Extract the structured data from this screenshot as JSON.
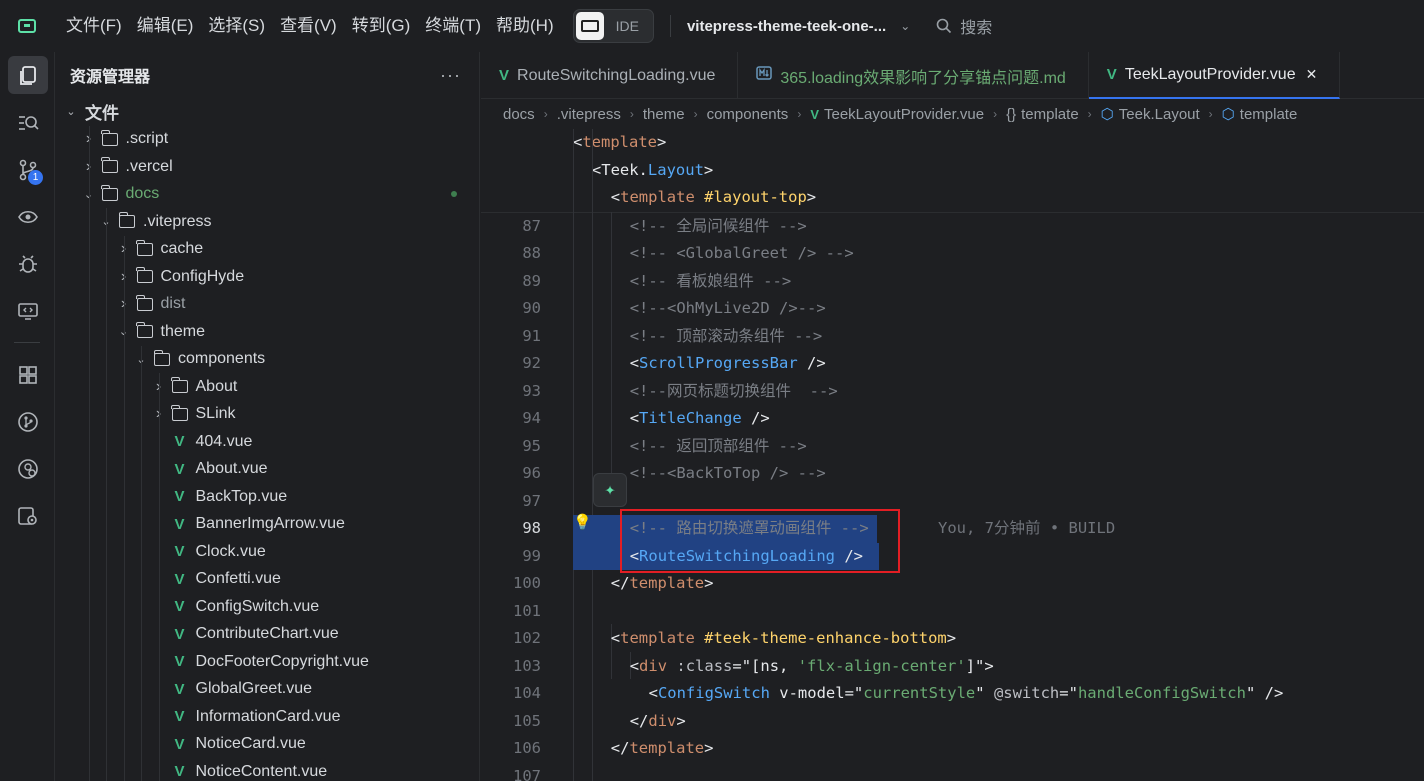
{
  "menu": [
    "文件(F)",
    "编辑(E)",
    "选择(S)",
    "查看(V)",
    "转到(G)",
    "终端(T)",
    "帮助(H)"
  ],
  "ide_label": "IDE",
  "project_name": "vitepress-theme-teek-one-...",
  "search_placeholder": "搜索",
  "activity": {
    "badge": "1"
  },
  "explorer": {
    "title": "资源管理器",
    "more": "···",
    "items": [
      {
        "label": "文件",
        "depth": 0,
        "type": "root",
        "expanded": true
      },
      {
        "label": ".script",
        "depth": 1,
        "type": "folder",
        "expanded": false
      },
      {
        "label": ".vercel",
        "depth": 1,
        "type": "folder",
        "expanded": false
      },
      {
        "label": "docs",
        "depth": 1,
        "type": "folder",
        "expanded": true,
        "modified": true
      },
      {
        "label": ".vitepress",
        "depth": 2,
        "type": "folder",
        "expanded": true
      },
      {
        "label": "cache",
        "depth": 3,
        "type": "folder",
        "expanded": false
      },
      {
        "label": "ConfigHyde",
        "depth": 3,
        "type": "folder",
        "expanded": false
      },
      {
        "label": "dist",
        "depth": 3,
        "type": "folder",
        "expanded": false,
        "dim": true
      },
      {
        "label": "theme",
        "depth": 3,
        "type": "folder",
        "expanded": true
      },
      {
        "label": "components",
        "depth": 4,
        "type": "folder",
        "expanded": true
      },
      {
        "label": "About",
        "depth": 5,
        "type": "folder",
        "expanded": false
      },
      {
        "label": "SLink",
        "depth": 5,
        "type": "folder",
        "expanded": false
      },
      {
        "label": "404.vue",
        "depth": 5,
        "type": "vue"
      },
      {
        "label": "About.vue",
        "depth": 5,
        "type": "vue"
      },
      {
        "label": "BackTop.vue",
        "depth": 5,
        "type": "vue"
      },
      {
        "label": "BannerImgArrow.vue",
        "depth": 5,
        "type": "vue"
      },
      {
        "label": "Clock.vue",
        "depth": 5,
        "type": "vue"
      },
      {
        "label": "Confetti.vue",
        "depth": 5,
        "type": "vue"
      },
      {
        "label": "ConfigSwitch.vue",
        "depth": 5,
        "type": "vue"
      },
      {
        "label": "ContributeChart.vue",
        "depth": 5,
        "type": "vue"
      },
      {
        "label": "DocFooterCopyright.vue",
        "depth": 5,
        "type": "vue"
      },
      {
        "label": "GlobalGreet.vue",
        "depth": 5,
        "type": "vue"
      },
      {
        "label": "InformationCard.vue",
        "depth": 5,
        "type": "vue"
      },
      {
        "label": "NoticeCard.vue",
        "depth": 5,
        "type": "vue"
      },
      {
        "label": "NoticeContent.vue",
        "depth": 5,
        "type": "vue"
      }
    ]
  },
  "tabs": [
    {
      "label": "RouteSwitchingLoading.vue",
      "type": "vue",
      "active": false
    },
    {
      "label": "365.loading效果影响了分享锚点问题.md",
      "type": "md",
      "active": false
    },
    {
      "label": "TeekLayoutProvider.vue",
      "type": "vue",
      "active": true,
      "close": "✕"
    }
  ],
  "breadcrumb": [
    "docs",
    ".vitepress",
    "theme",
    "components",
    "TeekLayoutProvider.vue",
    "template",
    "Teek.Layout",
    "template"
  ],
  "sticky": [
    {
      "text": "<template>",
      "indent": 0
    },
    {
      "text": "<Teek.Layout>",
      "indent": 1
    },
    {
      "text": "<template #layout-top>",
      "indent": 2
    }
  ],
  "code": [
    {
      "n": "87",
      "text": "<!-- 全局问候组件 -->"
    },
    {
      "n": "88",
      "text": "<!-- <GlobalGreet /> -->"
    },
    {
      "n": "89",
      "text": "<!-- 看板娘组件 -->"
    },
    {
      "n": "90",
      "text": "<!--<OhMyLive2D />-->"
    },
    {
      "n": "91",
      "text": "<!-- 顶部滚动条组件 -->"
    },
    {
      "n": "92",
      "text": "<ScrollProgressBar />"
    },
    {
      "n": "93",
      "text": "<!--网页标题切换组件  -->"
    },
    {
      "n": "94",
      "text": "<TitleChange />"
    },
    {
      "n": "95",
      "text": "<!-- 返回顶部组件 -->"
    },
    {
      "n": "96",
      "text": "<!--<BackToTop /> -->"
    },
    {
      "n": "97",
      "text": ""
    },
    {
      "n": "98",
      "text": "<!-- 路由切换遮罩动画组件 -->"
    },
    {
      "n": "99",
      "text": "<RouteSwitchingLoading />"
    },
    {
      "n": "100",
      "text": "</template>"
    },
    {
      "n": "101",
      "text": ""
    },
    {
      "n": "102",
      "text": "<template #teek-theme-enhance-bottom>"
    },
    {
      "n": "103",
      "text": "<div :class=\"[ns, 'flx-align-center']\">"
    },
    {
      "n": "104",
      "text": "<ConfigSwitch v-model=\"currentStyle\" @switch=\"handleConfigSwitch\" />"
    },
    {
      "n": "105",
      "text": "</div>"
    },
    {
      "n": "106",
      "text": "</template>"
    },
    {
      "n": "107",
      "text": ""
    }
  ],
  "blame": "You, 7分钟前 • BUILD",
  "colors": {
    "accent": "#3574f0",
    "vue": "#41b883",
    "highlight_box": "#e31e24",
    "selection": "#214283"
  }
}
